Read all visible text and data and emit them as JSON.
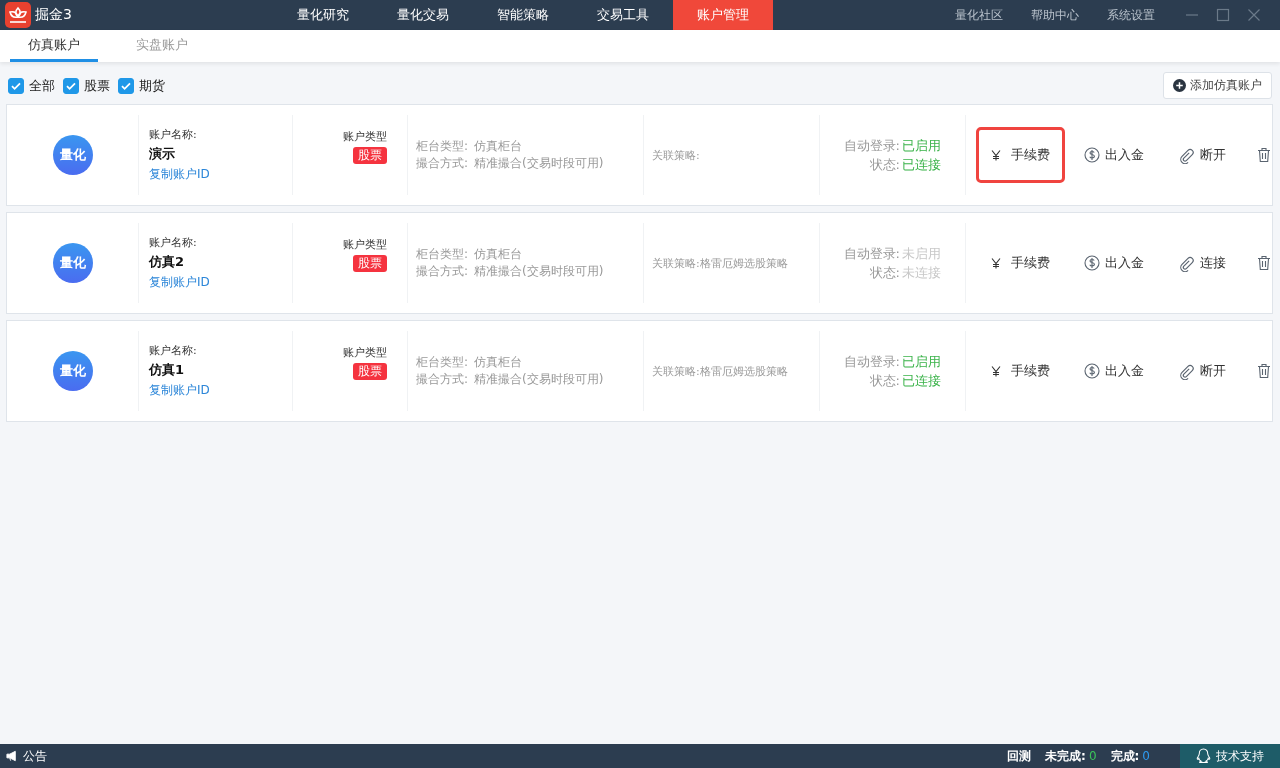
{
  "app": {
    "name": "掘金3"
  },
  "nav": [
    {
      "label": "量化研究",
      "selected": false
    },
    {
      "label": "量化交易",
      "selected": false
    },
    {
      "label": "智能策略",
      "selected": false
    },
    {
      "label": "交易工具",
      "selected": false
    },
    {
      "label": "账户管理",
      "selected": true
    }
  ],
  "header_links": [
    "量化社区",
    "帮助中心",
    "系统设置"
  ],
  "subtabs": [
    {
      "label": "仿真账户",
      "selected": true
    },
    {
      "label": "实盘账户",
      "selected": false
    }
  ],
  "filters": [
    {
      "label": "全部",
      "checked": true
    },
    {
      "label": "股票",
      "checked": true
    },
    {
      "label": "期货",
      "checked": true
    }
  ],
  "add_button": "添加仿真账户",
  "accounts": [
    {
      "avatar": "量化",
      "name_label": "账户名称:",
      "name": "演示",
      "copy_link": "复制账户ID",
      "type_label": "账户类型",
      "type_badge": "股票",
      "counter_label": "柜台类型:",
      "counter": "仿真柜台",
      "match_label": "撮合方式:",
      "match": "精准撮合(交易时段可用)",
      "strategy": "关联策略:",
      "login_label": "自动登录:",
      "login": "已启用",
      "login_on": true,
      "status_label": "状态:",
      "status": "已连接",
      "connected": true,
      "fee": "手续费",
      "fee_highlighted": true,
      "funds": "出入金",
      "connect": "断开"
    },
    {
      "avatar": "量化",
      "name_label": "账户名称:",
      "name": "仿真2",
      "copy_link": "复制账户ID",
      "type_label": "账户类型",
      "type_badge": "股票",
      "counter_label": "柜台类型:",
      "counter": "仿真柜台",
      "match_label": "撮合方式:",
      "match": "精准撮合(交易时段可用)",
      "strategy": "关联策略:格雷厄姆选股策略",
      "login_label": "自动登录:",
      "login": "未启用",
      "login_on": false,
      "status_label": "状态:",
      "status": "未连接",
      "connected": false,
      "fee": "手续费",
      "fee_highlighted": false,
      "funds": "出入金",
      "connect": "连接"
    },
    {
      "avatar": "量化",
      "name_label": "账户名称:",
      "name": "仿真1",
      "copy_link": "复制账户ID",
      "type_label": "账户类型",
      "type_badge": "股票",
      "counter_label": "柜台类型:",
      "counter": "仿真柜台",
      "match_label": "撮合方式:",
      "match": "精准撮合(交易时段可用)",
      "strategy": "关联策略:格雷厄姆选股策略",
      "login_label": "自动登录:",
      "login": "已启用",
      "login_on": true,
      "status_label": "状态:",
      "status": "已连接",
      "connected": true,
      "fee": "手续费",
      "fee_highlighted": false,
      "funds": "出入金",
      "connect": "断开"
    }
  ],
  "status_bar": {
    "notice": "公告",
    "backtest": "回测",
    "pending_label": "未完成:",
    "pending": "0",
    "done_label": "完成:",
    "done": "0",
    "support": "技术支持"
  }
}
